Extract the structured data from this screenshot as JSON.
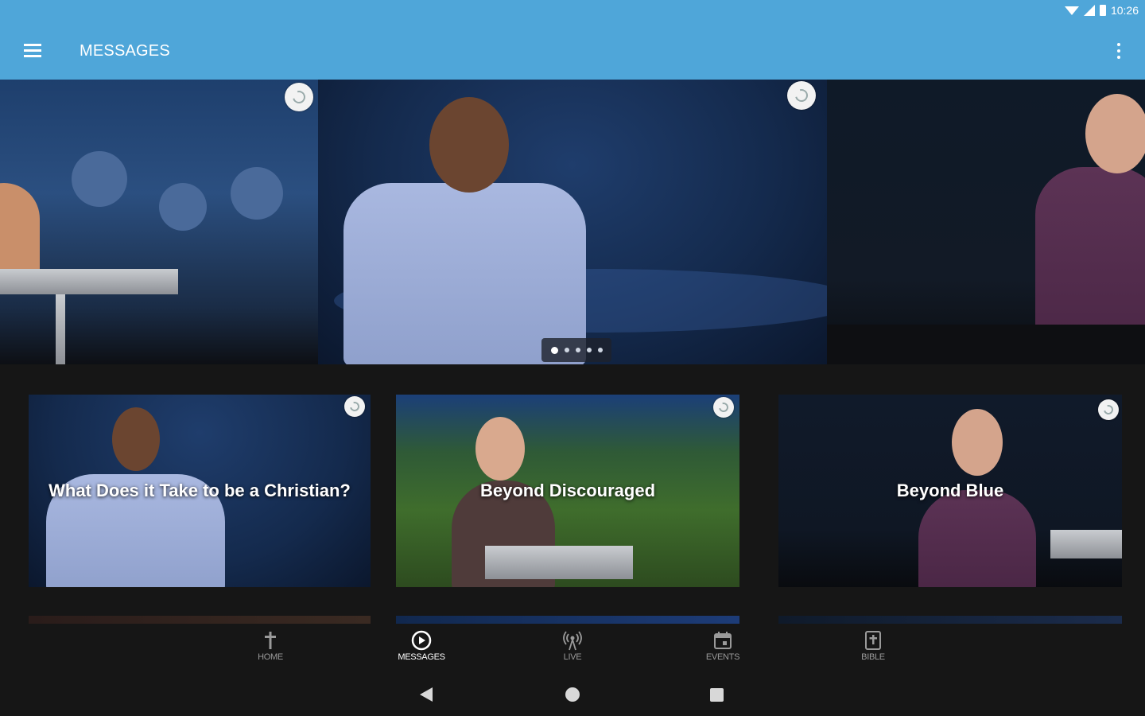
{
  "status_bar": {
    "time": "10:26"
  },
  "app_bar": {
    "title": "MESSAGES"
  },
  "carousel": {
    "slide_count": 5,
    "active_index": 0
  },
  "cards": [
    {
      "title": "What Does it Take to be a Christian?"
    },
    {
      "title": "Beyond Discouraged"
    },
    {
      "title": "Beyond Blue"
    }
  ],
  "bottom_nav": [
    {
      "label": "HOME",
      "icon": "cross-icon",
      "active": false
    },
    {
      "label": "MESSAGES",
      "icon": "play-circle-icon",
      "active": true
    },
    {
      "label": "LIVE",
      "icon": "broadcast-icon",
      "active": false
    },
    {
      "label": "EVENTS",
      "icon": "calendar-icon",
      "active": false
    },
    {
      "label": "BIBLE",
      "icon": "bible-icon",
      "active": false
    }
  ],
  "colors": {
    "app_bar": "#4fa6d9",
    "background": "#161616",
    "nav_inactive": "#9a9a9a",
    "nav_active": "#ffffff"
  }
}
